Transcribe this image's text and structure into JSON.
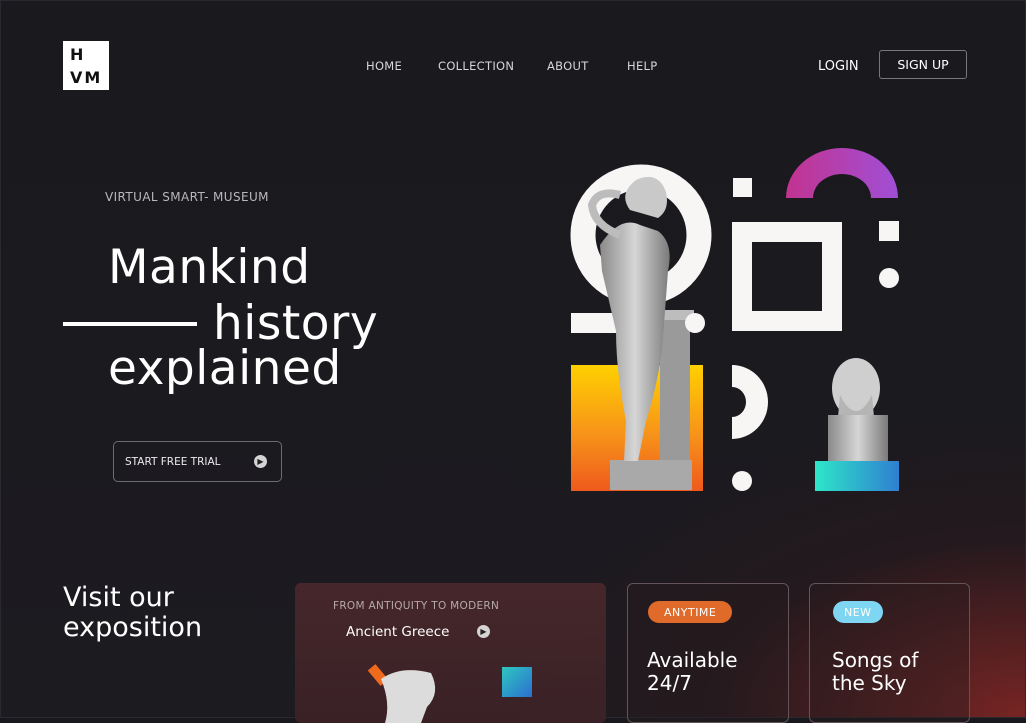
{
  "header": {
    "logo_line1": "H",
    "logo_line2": "VM",
    "nav": [
      "HOME",
      "COLLECTION",
      "ABOUT",
      "HELP"
    ],
    "login_label": "LOGIN",
    "signup_label": "SIGN UP"
  },
  "hero": {
    "eyebrow": "VIRTUAL SMART- MUSEUM",
    "title_line1": "Mankind",
    "title_line2": "history",
    "title_line3": "explained",
    "cta_label": "START FREE TRIAL"
  },
  "exposition": {
    "heading_line1": "Visit our",
    "heading_line2": "exposition",
    "feature_card": {
      "subtitle": "FROM ANTIQUITY TO MODERN",
      "title": "Ancient Greece"
    },
    "card_anytime": {
      "badge": "ANYTIME",
      "title_line1": "Available",
      "title_line2": "24/7"
    },
    "card_new": {
      "badge": "NEW",
      "title_line1": "Songs of",
      "title_line2": "the Sky"
    }
  },
  "colors": {
    "background": "#19181d",
    "accent_orange": "#e06a2a",
    "accent_cyan": "#7fd6f2",
    "gradient_pink": "#c2338f",
    "gradient_violet": "#a04fd6",
    "gradient_yellow": "#ffd000",
    "gradient_teal": "#2ee6c8"
  }
}
